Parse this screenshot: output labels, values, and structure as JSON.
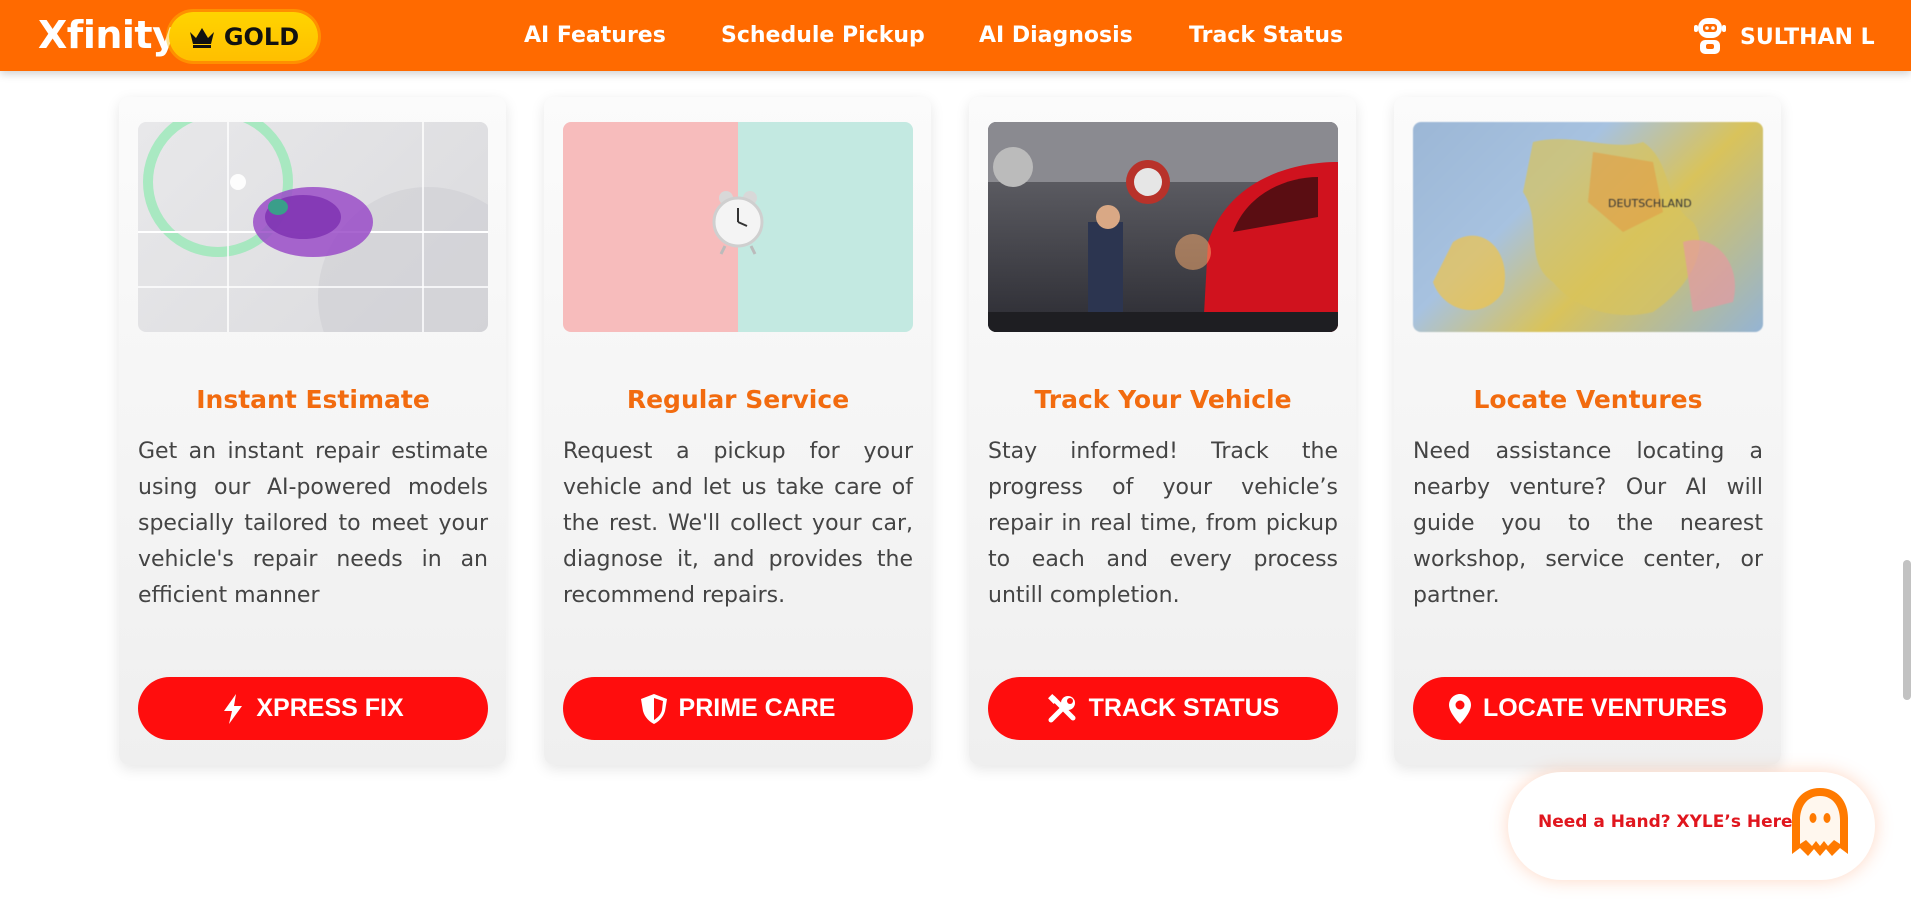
{
  "navbar": {
    "brand": "Xfinity",
    "badge": "GOLD",
    "links": [
      "AI Features",
      "Schedule Pickup",
      "AI Diagnosis",
      "Track Status"
    ],
    "user_name": "SULTHAN L"
  },
  "cards": [
    {
      "title": "Instant Estimate",
      "description": "Get an instant repair estimate using our AI-powered models specially tailored to meet your vehicle's repair needs in an efficient manner",
      "button": "XPRESS FIX",
      "icon": "lightning-icon"
    },
    {
      "title": "Regular Service",
      "description": "Request a pickup for your vehicle and let us take care of the rest. We'll collect your car, diagnose it, and provides the recommend repairs.",
      "button": "PRIME CARE",
      "icon": "shield-icon"
    },
    {
      "title": "Track Your Vehicle",
      "description": "Stay informed! Track the progress of your vehicle’s repair in real time, from pickup to each and every process untill completion.",
      "button": "TRACK STATUS",
      "icon": "tools-icon"
    },
    {
      "title": "Locate Ventures",
      "description": "Need assistance locating a nearby venture? Our AI will guide you to the nearest workshop, service center, or partner.",
      "button": "LOCATE VENTURES",
      "icon": "location-pin-icon"
    }
  ],
  "chat": {
    "text": "Need a Hand? XYLE’s Here!",
    "icon": "ghost-icon"
  },
  "colors": {
    "nav": "#ff6a00",
    "title": "#f26b0f",
    "button": "#ff0d0d",
    "badge": "#ffc800"
  }
}
